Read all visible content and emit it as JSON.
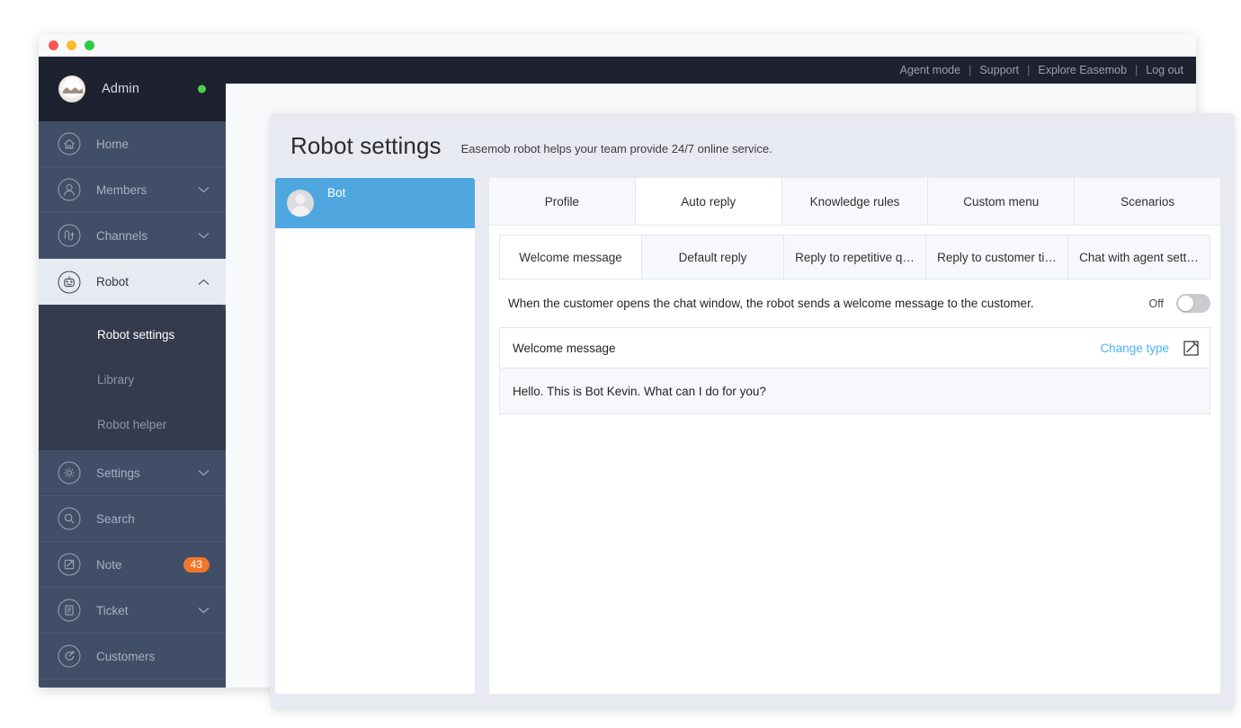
{
  "window": {
    "traffic_lights": [
      "close",
      "minimize",
      "maximize"
    ]
  },
  "topbar": {
    "links": [
      "Agent mode",
      "Support",
      "Explore Easemob",
      "Log out"
    ],
    "separator": "|"
  },
  "sidebar": {
    "user": {
      "name": "Admin",
      "status": "online",
      "status_color": "#4ed04e",
      "avatar": "welcome-avatar"
    },
    "items": [
      {
        "label": "Home",
        "icon": "home-icon",
        "chevron": false,
        "active": false
      },
      {
        "label": "Members",
        "icon": "members-icon",
        "chevron": "down",
        "active": false
      },
      {
        "label": "Channels",
        "icon": "channels-icon",
        "chevron": "down",
        "active": false
      },
      {
        "label": "Robot",
        "icon": "robot-icon",
        "chevron": "up",
        "active": true
      },
      {
        "label": "Settings",
        "icon": "gear-icon",
        "chevron": "down",
        "active": false
      },
      {
        "label": "Search",
        "icon": "search-icon",
        "chevron": false,
        "active": false
      },
      {
        "label": "Note",
        "icon": "note-icon",
        "chevron": false,
        "active": false,
        "badge": "43"
      },
      {
        "label": "Ticket",
        "icon": "ticket-icon",
        "chevron": "down",
        "active": false
      },
      {
        "label": "Customers",
        "icon": "customers-icon",
        "chevron": false,
        "active": false
      }
    ],
    "submenu": [
      {
        "label": "Robot settings",
        "active": true
      },
      {
        "label": "Library",
        "active": false
      },
      {
        "label": "Robot helper",
        "active": false
      }
    ],
    "badge_color": "#f2762a"
  },
  "page": {
    "title": "Robot settings",
    "subtitle": "Easemob robot helps your team provide 24/7 online service."
  },
  "bot_list": [
    {
      "name": "Bot",
      "selected": true,
      "avatar": "person-placeholder-icon"
    }
  ],
  "tabs": [
    {
      "label": "Profile",
      "active": false
    },
    {
      "label": "Auto reply",
      "active": true
    },
    {
      "label": "Knowledge rules",
      "active": false
    },
    {
      "label": "Custom menu",
      "active": false
    },
    {
      "label": "Scenarios",
      "active": false
    }
  ],
  "subtabs": [
    {
      "label": "Welcome message",
      "active": true
    },
    {
      "label": "Default reply",
      "active": false
    },
    {
      "label": "Reply to repetitive q…",
      "active": false
    },
    {
      "label": "Reply to customer ti…",
      "active": false
    },
    {
      "label": "Chat with agent sett…",
      "active": false
    }
  ],
  "toggle": {
    "description": "When the customer opens the chat window, the robot sends a welcome message to the customer.",
    "state_label": "Off",
    "enabled": false
  },
  "message_card": {
    "title": "Welcome message",
    "change_type_label": "Change type",
    "edit_icon": "edit-square-icon",
    "body": "Hello. This is Bot Kevin. What can I do for you?"
  },
  "colors": {
    "accent_blue": "#4ab3ef",
    "selected_bot": "#50a7e0",
    "sidebar_bg": "#414e68",
    "sidebar_head_bg": "#1e2130",
    "submenu_bg": "#343b4d",
    "content_bg": "#e7eaf1"
  }
}
